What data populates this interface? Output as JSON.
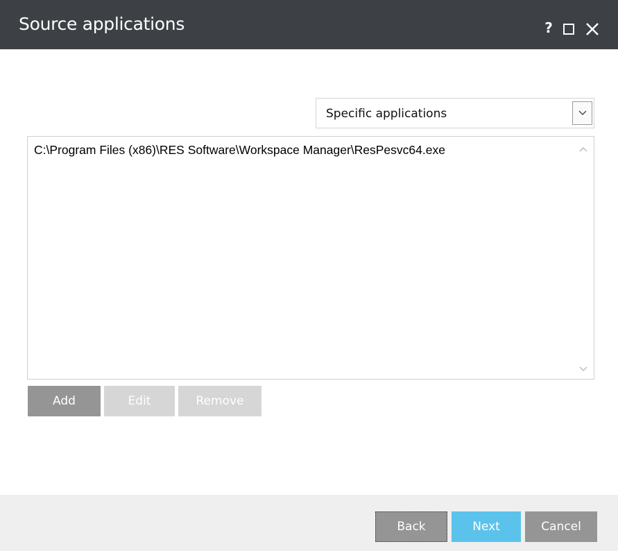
{
  "window": {
    "title": "Source applications",
    "help_label": "?",
    "maximize_icon": "maximize-icon",
    "close_icon": "close-icon"
  },
  "source_select": {
    "value": "Specific applications",
    "arrow_icon": "chevron-down-icon"
  },
  "app_list": {
    "items": [
      "C:\\Program Files (x86)\\RES Software\\Workspace Manager\\ResPesvc64.exe"
    ]
  },
  "list_buttons": {
    "add_label": "Add",
    "edit_label": "Edit",
    "remove_label": "Remove"
  },
  "footer": {
    "back_label": "Back",
    "next_label": "Next",
    "cancel_label": "Cancel"
  },
  "colors": {
    "titlebar": "#3d4045",
    "accent": "#5bc2ec",
    "button": "#959595",
    "disabled_button": "#d6d6d6"
  }
}
